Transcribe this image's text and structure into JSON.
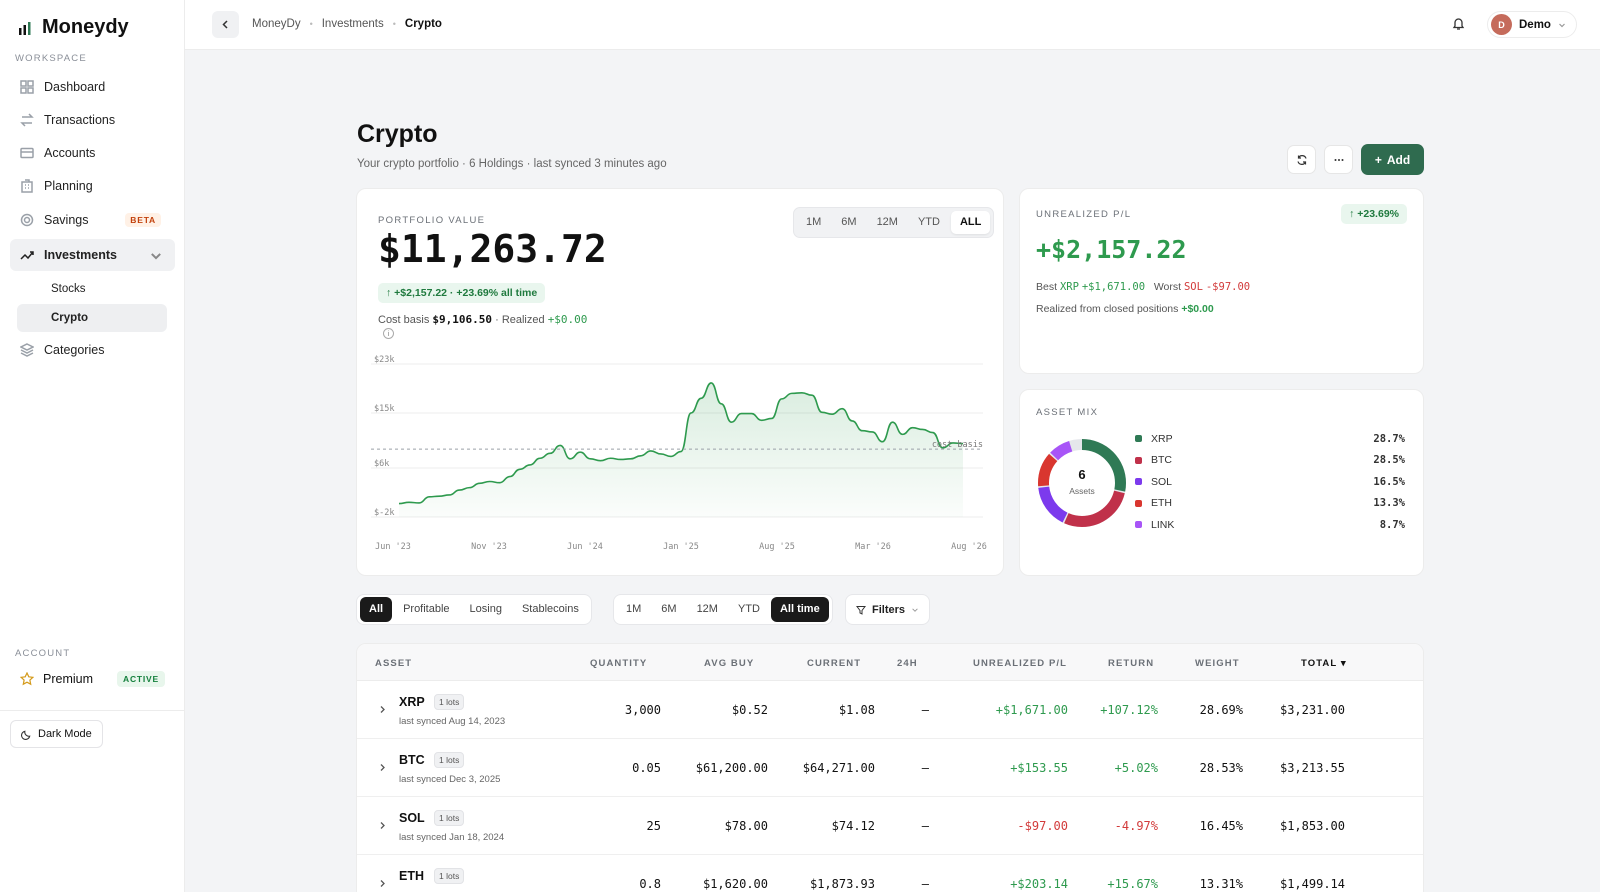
{
  "app": {
    "name": "Moneydy"
  },
  "sidebar": {
    "workspace_label": "WORKSPACE",
    "items": [
      {
        "label": "Dashboard",
        "icon": "grid-icon"
      },
      {
        "label": "Transactions",
        "icon": "arrows-icon"
      },
      {
        "label": "Accounts",
        "icon": "card-icon"
      },
      {
        "label": "Planning",
        "icon": "building-icon"
      },
      {
        "label": "Savings",
        "icon": "target-icon",
        "badge": "BETA"
      },
      {
        "label": "Investments",
        "icon": "trend-icon",
        "active": true
      }
    ],
    "sub_items": [
      {
        "label": "Stocks"
      },
      {
        "label": "Crypto",
        "active": true
      }
    ],
    "categories_label": "Categories",
    "account_label": "ACCOUNT",
    "premium": {
      "label": "Premium",
      "badge": "ACTIVE"
    },
    "dark_mode_label": "Dark Mode"
  },
  "topbar": {
    "breadcrumbs": [
      "MoneyDy",
      "Investments",
      "Crypto"
    ],
    "user": {
      "initial": "D",
      "name": "Demo"
    }
  },
  "page": {
    "title": "Crypto",
    "subtitle": "Your crypto portfolio · 6 Holdings · last synced 3 minutes ago",
    "add_label": "Add"
  },
  "portfolio": {
    "label": "PORTFOLIO VALUE",
    "value": "$11,263.72",
    "change": "↑ +$2,157.22 · +23.69% all time",
    "cost_basis_label": "Cost basis",
    "cost_basis": "$9,106.50",
    "realized_label": "· Realized",
    "realized": "+$0.00",
    "ranges": [
      "1M",
      "6M",
      "12M",
      "YTD",
      "ALL"
    ],
    "active_range": "ALL"
  },
  "chart_data": {
    "type": "area",
    "y_ticks": [
      "$23k",
      "$15k",
      "$6k",
      "$-2k"
    ],
    "x_ticks": [
      "Jun '23",
      "Nov '23",
      "Jun '24",
      "Jan '25",
      "Aug '25",
      "Mar '26",
      "Aug '26"
    ],
    "ylim": [
      -2,
      23
    ],
    "unit": "thousand USD",
    "reference_line": {
      "label": "cost basis",
      "value": 9.1
    },
    "series": [
      {
        "values": [
          0.2,
          0.4,
          0.3,
          1.3,
          1.4,
          1.6,
          2.4,
          2.8,
          3.5,
          3.8,
          3.6,
          4.6,
          5.8,
          6.5,
          7.6,
          8.4,
          9.7,
          7.5,
          8.6,
          7.5,
          7.2,
          7.6,
          7.4,
          7.5,
          8.0,
          8.8,
          8.3,
          7.9,
          8.7,
          15.0,
          17.4,
          19.9,
          16.5,
          13.5,
          14.9,
          14.9,
          13.8,
          14.1,
          17.3,
          18.2,
          18.3,
          17.9,
          15.1,
          14.8,
          15.7,
          13.7,
          12.1,
          11.9,
          10.3,
          13.5,
          11.5,
          12.6,
          12.3,
          11.8,
          9.3,
          10.1,
          10.0
        ]
      }
    ],
    "line_color": "#2e9a4e",
    "grid": true
  },
  "unrealized": {
    "label": "UNREALIZED P/L",
    "badge": "↑ +23.69%",
    "value": "+$2,157.22",
    "best_label": "Best",
    "best_symbol": "XRP",
    "best_value": "+$1,671.00",
    "worst_label": "Worst",
    "worst_symbol": "SOL",
    "worst_value": "-$97.00",
    "realized_label": "Realized from closed positions",
    "realized_value": "+$0.00"
  },
  "asset_mix": {
    "label": "ASSET MIX",
    "center_count": "6",
    "center_label": "Assets",
    "items": [
      {
        "name": "XRP",
        "pct": "28.7%",
        "value": 28.7,
        "color": "#2f7a55"
      },
      {
        "name": "BTC",
        "pct": "28.5%",
        "value": 28.5,
        "color": "#c0314a"
      },
      {
        "name": "SOL",
        "pct": "16.5%",
        "value": 16.5,
        "color": "#7c3aed"
      },
      {
        "name": "ETH",
        "pct": "13.3%",
        "value": 13.3,
        "color": "#d9362f"
      },
      {
        "name": "LINK",
        "pct": "8.7%",
        "value": 8.7,
        "color": "#a855f7"
      }
    ],
    "other_color": "#e5e7eb"
  },
  "filters": {
    "type_tabs": [
      "All",
      "Profitable",
      "Losing",
      "Stablecoins"
    ],
    "active_type": "All",
    "range_tabs": [
      "1M",
      "6M",
      "12M",
      "YTD",
      "All time"
    ],
    "active_range": "All time",
    "filters_label": "Filters"
  },
  "table": {
    "headers": {
      "asset": "ASSET",
      "quantity": "QUANTITY",
      "avg_buy": "AVG BUY",
      "current": "CURRENT",
      "h24": "24H",
      "pl": "UNREALIZED P/L",
      "ret": "RETURN",
      "weight": "WEIGHT",
      "total": "TOTAL ▾"
    },
    "rows": [
      {
        "symbol": "XRP",
        "lots": "1 lots",
        "synced": "last synced Aug 14, 2023",
        "quantity": "3,000",
        "avg_buy": "$0.52",
        "current": "$1.08",
        "h24": "—",
        "pl": "+$1,671.00",
        "ret": "+107.12%",
        "weight": "28.69%",
        "total": "$3,231.00",
        "positive": true
      },
      {
        "symbol": "BTC",
        "lots": "1 lots",
        "synced": "last synced Dec 3, 2025",
        "quantity": "0.05",
        "avg_buy": "$61,200.00",
        "current": "$64,271.00",
        "h24": "—",
        "pl": "+$153.55",
        "ret": "+5.02%",
        "weight": "28.53%",
        "total": "$3,213.55",
        "positive": true
      },
      {
        "symbol": "SOL",
        "lots": "1 lots",
        "synced": "last synced Jan 18, 2024",
        "quantity": "25",
        "avg_buy": "$78.00",
        "current": "$74.12",
        "h24": "—",
        "pl": "-$97.00",
        "ret": "-4.97%",
        "weight": "16.45%",
        "total": "$1,853.00",
        "positive": false
      },
      {
        "symbol": "ETH",
        "lots": "1 lots",
        "synced": "",
        "quantity": "0.8",
        "avg_buy": "$1,620.00",
        "current": "$1,873.93",
        "h24": "—",
        "pl": "+$203.14",
        "ret": "+15.67%",
        "weight": "13.31%",
        "total": "$1,499.14",
        "positive": true
      }
    ]
  }
}
